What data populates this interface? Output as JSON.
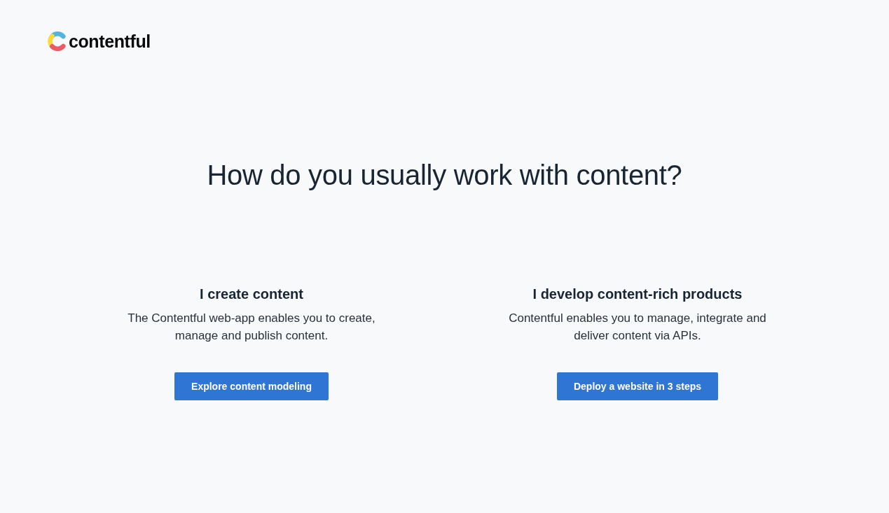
{
  "logo": {
    "wordmark": "contentful"
  },
  "heading": "How do you usually work with content?",
  "options": [
    {
      "title": "I create content",
      "description": "The Contentful web-app enables you to create, manage and publish content.",
      "button": "Explore content modeling"
    },
    {
      "title": "I develop content-rich products",
      "description": "Contentful enables you to manage, integrate and deliver content via APIs.",
      "button": "Deploy a website in 3 steps"
    }
  ]
}
